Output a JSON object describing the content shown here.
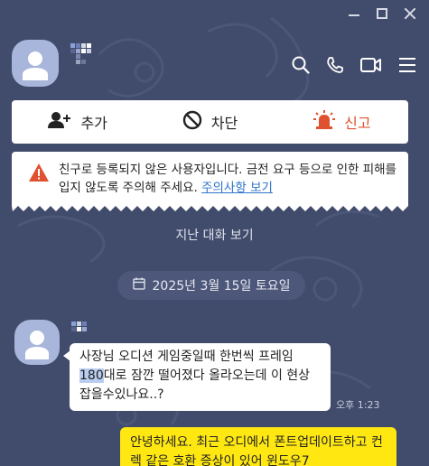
{
  "window": {
    "controls": [
      "minimize",
      "maximize",
      "close"
    ]
  },
  "header": {
    "contact_name_shown_as": "pixelated",
    "icons": [
      "search-icon",
      "phone-icon",
      "video-icon",
      "menu-icon"
    ]
  },
  "actions": [
    {
      "id": "add",
      "label": "추가",
      "icon": "add-user-icon"
    },
    {
      "id": "block",
      "label": "차단",
      "icon": "block-icon"
    },
    {
      "id": "report",
      "label": "신고",
      "icon": "siren-icon",
      "color": "#e0522f"
    }
  ],
  "warning": {
    "text": "친구로 등록되지 않은 사용자입니다. 금전 요구 등으로 인한 피해를 입지 않도록 주의해 주세요.",
    "link": "주의사항 보기",
    "accent": "#e0522f"
  },
  "history_link": "지난 대화 보기",
  "date_divider": "2025년 3월 15일 토요일",
  "messages": [
    {
      "direction": "in",
      "text_before": "사장님 오디션 게임중일때 한번씩 프레임 ",
      "highlight": "180",
      "text_after": "대로 잠깐 떨어졌다 올라오는데 이 현상 잡을수있나요..?",
      "time": "오후 1:23"
    },
    {
      "direction": "out",
      "text": "안녕하세요. 최근 오디에서 폰트업데이트하고 컨렉 같은 호환 증상이 있어 윈도우7"
    }
  ],
  "colors": {
    "background": "#414b6b",
    "bubble_out": "#ffe812",
    "bubble_in": "#ffffff",
    "link": "#2f75c9"
  }
}
